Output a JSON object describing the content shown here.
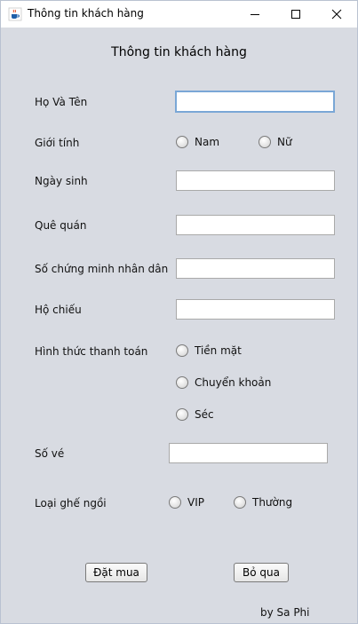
{
  "window": {
    "title": "Thông tin khách hàng",
    "app_icon": "java-cup-icon"
  },
  "form": {
    "heading": "Thông tin khách hàng",
    "ho_ten": {
      "label": "Họ Và Tên",
      "value": ""
    },
    "gioi_tinh": {
      "label": "Giới tính",
      "options": [
        "Nam",
        "Nữ"
      ]
    },
    "ngay_sinh": {
      "label": "Ngày sinh",
      "value": ""
    },
    "que_quan": {
      "label": "Quê quán",
      "value": ""
    },
    "cmnd": {
      "label": "Số chứng minh nhân dân",
      "value": ""
    },
    "ho_chieu": {
      "label": "Hộ chiếu",
      "value": ""
    },
    "thanh_toan": {
      "label": "Hình thức thanh toán",
      "options": [
        "Tiền mặt",
        "Chuyển khoản",
        "Séc"
      ]
    },
    "so_ve": {
      "label": "Số vé",
      "value": ""
    },
    "loai_ghe": {
      "label": "Loại ghế ngồi",
      "options": [
        "VIP",
        "Thường"
      ]
    }
  },
  "buttons": {
    "dat_mua": "Đặt mua",
    "bo_qua": "Bỏ qua"
  },
  "footer": {
    "credit": "by Sa Phi"
  }
}
